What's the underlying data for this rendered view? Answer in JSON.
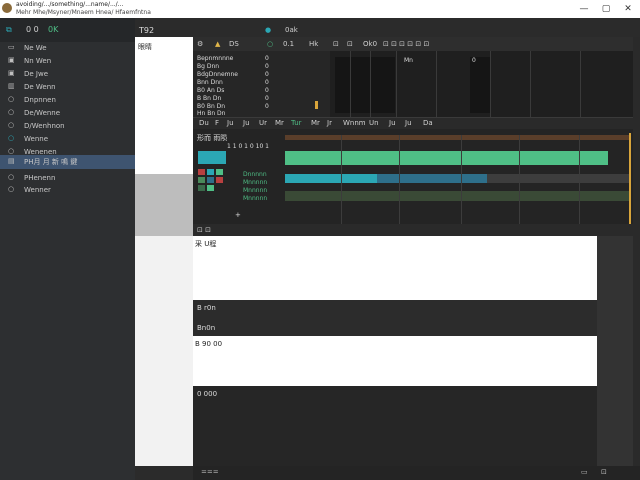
{
  "window": {
    "title_line1": "avoiding/.../something/...name/.../...",
    "title_line2": "Mehr Mhe/Msyner/Mnaem Hnea/ Hfaemfntna",
    "controls": [
      "—",
      "▢",
      "✕"
    ]
  },
  "sidebar": {
    "toolbar": [
      "⧉",
      "0 0",
      "0K"
    ],
    "items": [
      {
        "label": "Ne We",
        "icon": "folder-icon"
      },
      {
        "label": "Nn Wen",
        "icon": "image-icon"
      },
      {
        "label": "De Jwe",
        "icon": "image-icon"
      },
      {
        "label": "De Wenn",
        "icon": "chart-icon"
      },
      {
        "label": "Dnpnnen",
        "icon": "search-icon"
      },
      {
        "label": "De/Wenne",
        "icon": "circle-icon"
      },
      {
        "label": "D/Wenhnon",
        "icon": "circle-icon"
      },
      {
        "label": "Wenne",
        "icon": "circle-icon"
      },
      {
        "label": "Wenenen",
        "icon": "circle-icon"
      },
      {
        "label": "PH月 月 新 鳴 鍵",
        "icon": "document-icon",
        "selected": true
      },
      {
        "label": "PHenenn",
        "icon": "circle-icon"
      },
      {
        "label": "Wenner",
        "icon": "circle-icon"
      }
    ]
  },
  "header": {
    "left_label": "T92",
    "tree_label": "眼睛"
  },
  "main_toolbar": {
    "items": [
      "⚙",
      "▲",
      "DS",
      "○",
      "0.1",
      "Hk",
      "●",
      "0ak",
      "⊡",
      "⊡",
      "Ok0",
      "⊡ ⊡ ⊡ ⊡ ⊡ ⊡"
    ]
  },
  "left_list": [
    {
      "name": "Bepnmnnne",
      "val": "0"
    },
    {
      "name": "Bg Dnn",
      "val": "0"
    },
    {
      "name": "BdgDnnemne",
      "val": "0"
    },
    {
      "name": "Bnn Dnn",
      "val": "0"
    },
    {
      "name": "B0 An Ds",
      "val": "0"
    },
    {
      "name": "B Bn Dn",
      "val": "0"
    },
    {
      "name": "B0 Bn Dn",
      "val": "0"
    },
    {
      "name": "Hn Bn Dn",
      "val": "0"
    }
  ],
  "grid_labels": [
    "Mn",
    "0"
  ],
  "mid_toolbar": {
    "items": [
      "Du",
      "F",
      "Ju",
      "Ju",
      "Ur",
      "Mr",
      "Tur",
      "Mr",
      "Jr",
      "Wnnm",
      "Un",
      "Ju",
      "Ju",
      "Da"
    ]
  },
  "timeline": {
    "header": "形而 雨陨",
    "track_label": "1 1 0 1 0 10 1",
    "labels": [
      "Dnnnnn",
      "Mnnnnn",
      "Mnnnnn",
      "Mnnnnn"
    ],
    "legend": [
      "+",
      "+"
    ],
    "colors": {
      "green": "#4fbf86",
      "teal": "#2ba7b4",
      "blue": "#2e6f8a",
      "dark_green": "#3a4a36",
      "brown": "#5a3e2a"
    }
  },
  "panel1": {
    "label": "采 U程"
  },
  "panel2": {
    "label": "B r0n"
  },
  "panel3": {
    "label": "Bn0n"
  },
  "panel4": {
    "label": "B 90 00"
  },
  "panel5": {
    "label": "0 000"
  },
  "status": {
    "text": "==="
  }
}
